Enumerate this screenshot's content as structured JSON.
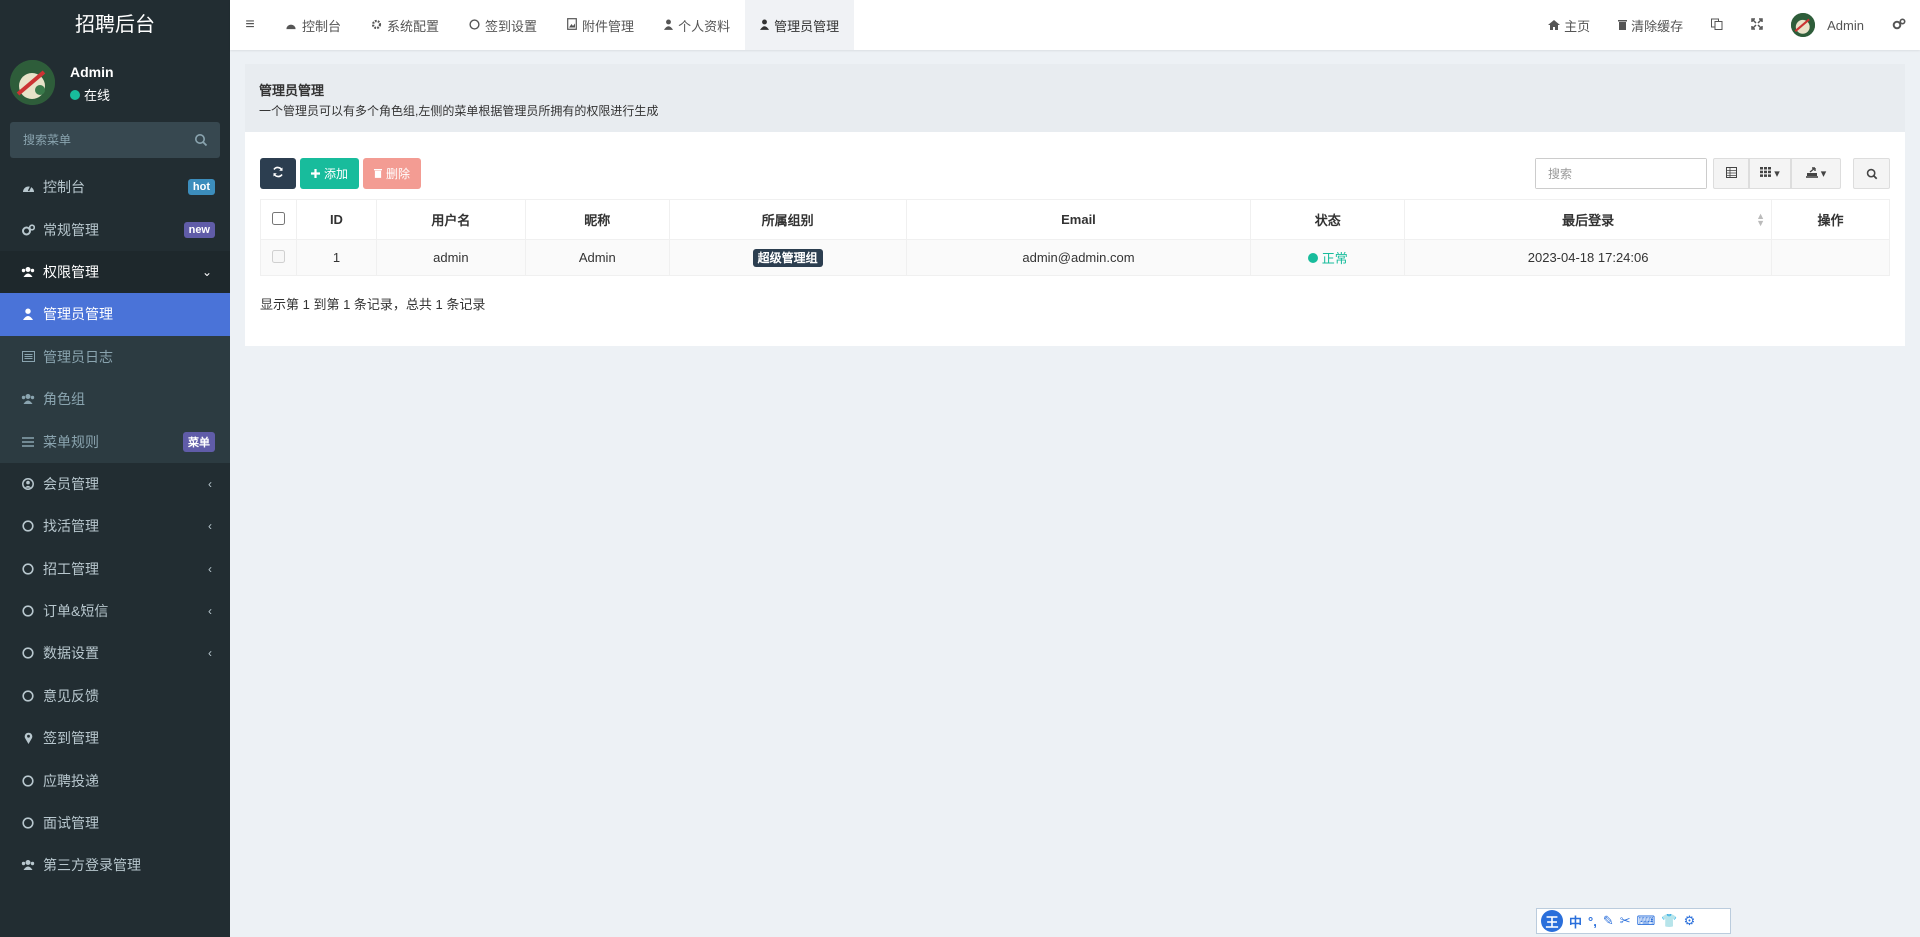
{
  "app": {
    "title": "招聘后台"
  },
  "user": {
    "name": "Admin",
    "status": "在线"
  },
  "sidebar": {
    "search_placeholder": "搜索菜单",
    "items": [
      {
        "label": "控制台",
        "icon": "dashboard-icon",
        "badge": "hot"
      },
      {
        "label": "常规管理",
        "icon": "cogs-icon",
        "badge": "new"
      },
      {
        "label": "权限管理",
        "icon": "group-icon",
        "expanded": true
      },
      {
        "label": "管理员管理",
        "icon": "user-icon",
        "active": true
      },
      {
        "label": "管理员日志",
        "icon": "list-alt-icon"
      },
      {
        "label": "角色组",
        "icon": "group-icon"
      },
      {
        "label": "菜单规则",
        "icon": "bars-icon",
        "badge": "菜单"
      },
      {
        "label": "会员管理",
        "icon": "user-circle-icon"
      },
      {
        "label": "找活管理",
        "icon": "circle-icon"
      },
      {
        "label": "招工管理",
        "icon": "circle-icon"
      },
      {
        "label": "订单&短信",
        "icon": "circle-icon"
      },
      {
        "label": "数据设置",
        "icon": "circle-icon"
      },
      {
        "label": "意见反馈",
        "icon": "circle-icon"
      },
      {
        "label": "签到管理",
        "icon": "map-marker-icon"
      },
      {
        "label": "应聘投递",
        "icon": "circle-icon"
      },
      {
        "label": "面试管理",
        "icon": "circle-icon"
      },
      {
        "label": "第三方登录管理",
        "icon": "group-icon"
      }
    ]
  },
  "navbar": {
    "tabs": [
      {
        "label": "控制台",
        "icon": "dashboard-icon"
      },
      {
        "label": "系统配置",
        "icon": "gear-icon"
      },
      {
        "label": "签到设置",
        "icon": "circle-icon"
      },
      {
        "label": "附件管理",
        "icon": "file-image-icon"
      },
      {
        "label": "个人资料",
        "icon": "user-icon"
      },
      {
        "label": "管理员管理",
        "icon": "user-icon",
        "active": true
      }
    ],
    "right": {
      "home": "主页",
      "clear_cache": "清除缓存",
      "user": "Admin"
    }
  },
  "page": {
    "title": "管理员管理",
    "description": "一个管理员可以有多个角色组,左侧的菜单根据管理员所拥有的权限进行生成",
    "toolbar": {
      "add": "添加",
      "delete": "删除"
    },
    "search_placeholder": "搜索",
    "table": {
      "columns": [
        "ID",
        "用户名",
        "昵称",
        "所属组别",
        "Email",
        "状态",
        "最后登录",
        "操作"
      ],
      "rows": [
        {
          "id": "1",
          "username": "admin",
          "nickname": "Admin",
          "group": "超级管理组",
          "email": "admin@admin.com",
          "status": "正常",
          "last_login": "2023-04-18 17:24:06",
          "ops": ""
        }
      ]
    },
    "pager_text": "显示第 1 到第 1 条记录，总共 1 条记录"
  },
  "ime": {
    "labels": [
      "中"
    ]
  },
  "colors": {
    "sidebar_bg": "#222d32",
    "active_item": "#4a73d8",
    "success": "#18bc9c",
    "dark": "#2c3e50",
    "danger_light": "#f39c93"
  }
}
